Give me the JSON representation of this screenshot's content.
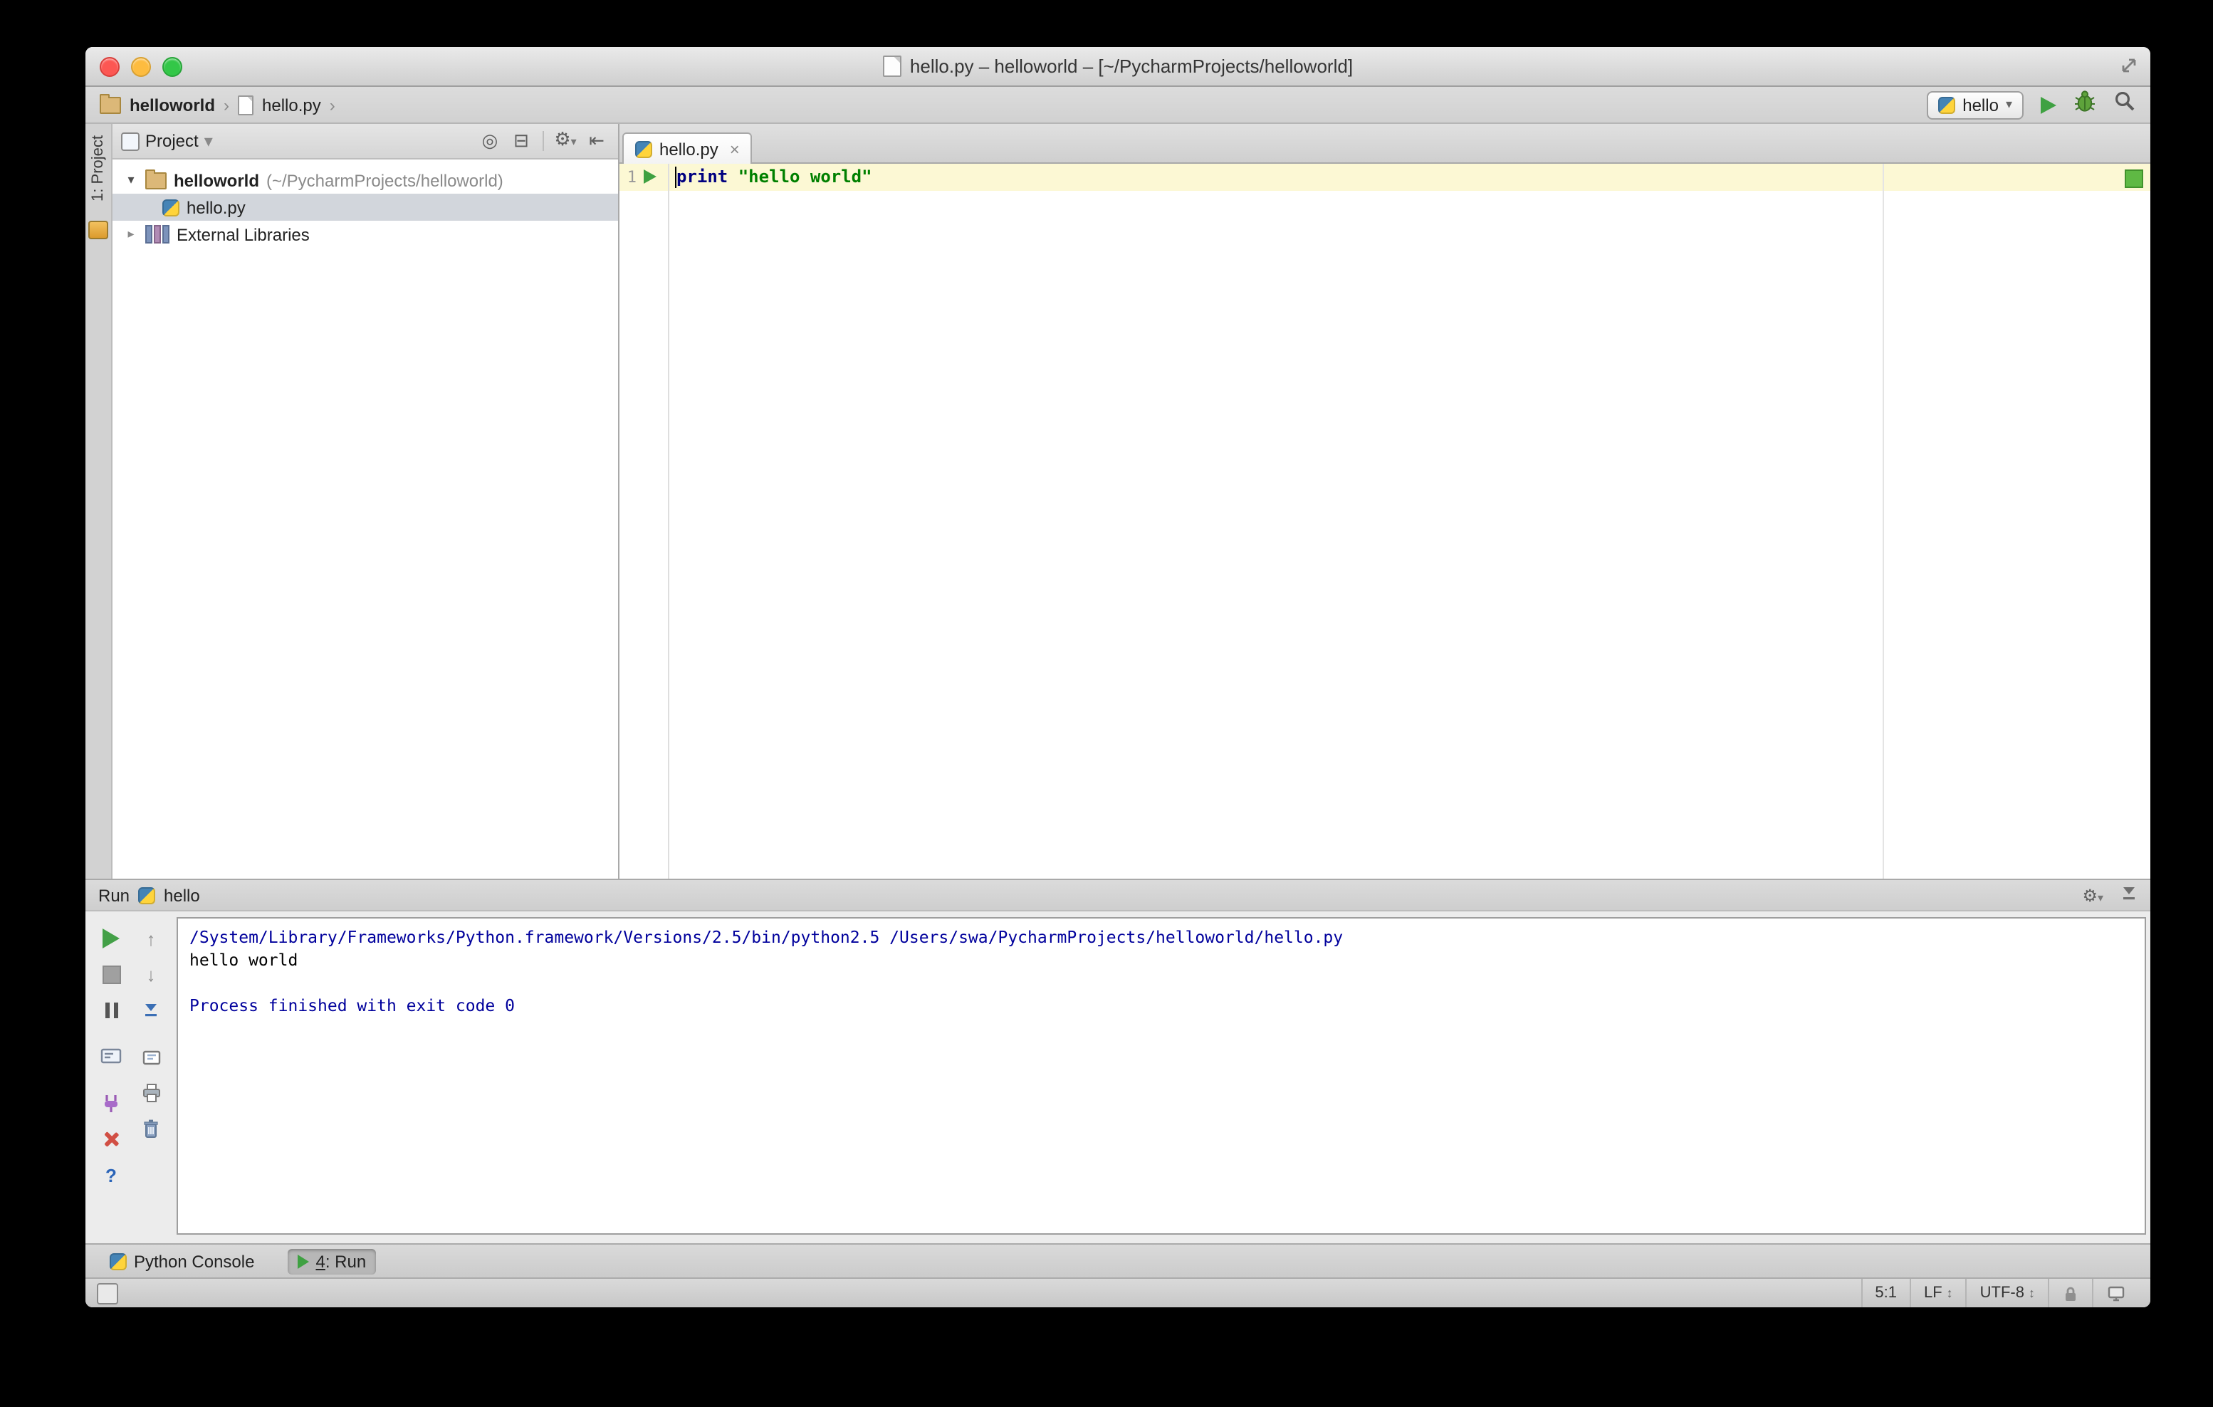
{
  "window": {
    "title": "hello.py – helloworld – [~/PycharmProjects/helloworld]"
  },
  "toolbar": {
    "breadcrumbs": [
      {
        "label": "helloworld"
      },
      {
        "label": "hello.py"
      }
    ],
    "run_config": {
      "label": "hello"
    }
  },
  "left_stripe": {
    "label": "1: Project"
  },
  "project_panel": {
    "header": {
      "label": "Project"
    },
    "tree": [
      {
        "label": "helloworld",
        "suffix": "(~/PycharmProjects/helloworld)"
      },
      {
        "label": "hello.py"
      },
      {
        "label": "External Libraries"
      }
    ]
  },
  "editor": {
    "tab": {
      "label": "hello.py"
    },
    "gutter": {
      "line_number": "1"
    },
    "code": {
      "keyword": "print",
      "space": " ",
      "string": "\"hello world\""
    }
  },
  "run_panel": {
    "title": "Run",
    "config_label": "hello",
    "console": {
      "lines": [
        {
          "text": "/System/Library/Frameworks/Python.framework/Versions/2.5/bin/python2.5 /Users/swa/PycharmProjects/helloworld/hello.py"
        },
        {
          "text": "hello world"
        },
        {
          "text": ""
        },
        {
          "text": "Process finished with exit code 0"
        }
      ]
    }
  },
  "bottom_bar": {
    "python_console_label": "Python Console",
    "run_tab": {
      "mnemonic": "4",
      "rest": ": Run"
    }
  },
  "status_bar": {
    "caret_position": "5:1",
    "line_separator": "LF",
    "encoding": "UTF-8"
  },
  "icons": {
    "breadcrumb_chevron": "›",
    "dropdown_arrow": "▾",
    "tree_expanded": "▾",
    "tree_collapsed": "▸",
    "tab_close": "×",
    "gear": "⚙",
    "locate": "◎",
    "collapse_all": "⊟",
    "hide_panel": "⇤",
    "scroll_up": "↑",
    "scroll_down": "↓",
    "help": "?",
    "updown": "↕"
  },
  "colors": {
    "keyword": "#000080",
    "string": "#008000",
    "console_system": "#00009c",
    "run_green": "#3fa142",
    "current_line": "#fcf8d4",
    "selection": "#d2d6dc",
    "marker": "#5fb944"
  }
}
